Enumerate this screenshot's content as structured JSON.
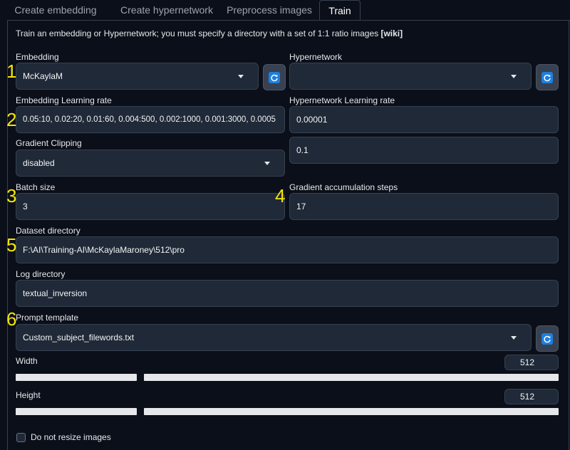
{
  "tabs": [
    {
      "label": "Create embedding",
      "active": false
    },
    {
      "label": "Create hypernetwork",
      "active": false
    },
    {
      "label": "Preprocess images",
      "active": false
    },
    {
      "label": "Train",
      "active": true
    }
  ],
  "intro": {
    "text": "Train an embedding or Hypernetwork; you must specify a directory with a set of 1:1 ratio images ",
    "link": "[wiki]"
  },
  "annotations": [
    "1",
    "2",
    "3",
    "4",
    "5",
    "6"
  ],
  "embedding": {
    "label": "Embedding",
    "value": "McKaylaM"
  },
  "hypernetwork": {
    "label": "Hypernetwork",
    "value": ""
  },
  "embedding_lr": {
    "label": "Embedding Learning rate",
    "value": "0.05:10, 0.02:20, 0.01:60, 0.004:500, 0.002:1000, 0.001:3000, 0.0005"
  },
  "hypernetwork_lr": {
    "label": "Hypernetwork Learning rate",
    "value": "0.00001"
  },
  "gradient_clipping": {
    "label": "Gradient Clipping",
    "value": "disabled",
    "extra_value": "0.1"
  },
  "batch_size": {
    "label": "Batch size",
    "value": "3"
  },
  "gradient_accumulation": {
    "label": "Gradient accumulation steps",
    "value": "17"
  },
  "dataset_directory": {
    "label": "Dataset directory",
    "value": "F:\\AI\\Training-AI\\McKaylaMaroney\\512\\pro"
  },
  "log_directory": {
    "label": "Log directory",
    "value": "textual_inversion"
  },
  "prompt_template": {
    "label": "Prompt template",
    "value": "Custom_subject_filewords.txt"
  },
  "width": {
    "label": "Width",
    "value": "512"
  },
  "height": {
    "label": "Height",
    "value": "512"
  },
  "no_resize": {
    "label": "Do not resize images",
    "checked": false
  },
  "colors": {
    "accent_refresh": "#1d7fe0",
    "annotation": "#f5e50a",
    "background": "#0b0f19",
    "field": "#1f2937"
  }
}
